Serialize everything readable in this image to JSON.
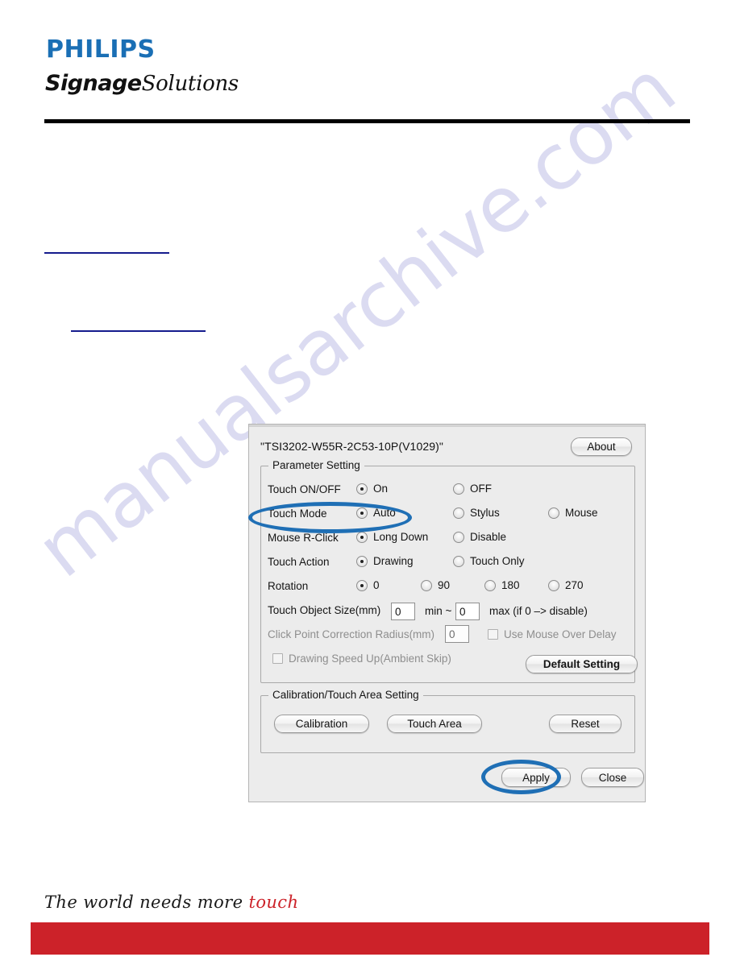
{
  "watermark": {
    "text": "manualsarchive.com"
  },
  "header": {
    "brand": "PHILIPS",
    "sub_bold": "Signage",
    "sub_light": "Solutions"
  },
  "dialog": {
    "device_id": "\"TSI3202-W55R-2C53-10P(V1029)\"",
    "about_label": "About",
    "parameter_group_label": "Parameter Setting",
    "rows": {
      "touch_onoff": {
        "label": "Touch ON/OFF",
        "options": [
          "On",
          "OFF"
        ],
        "selected": "On"
      },
      "touch_mode": {
        "label": "Touch Mode",
        "options": [
          "Auto",
          "Stylus",
          "Mouse"
        ],
        "selected": "Auto"
      },
      "mouse_rclick": {
        "label": "Mouse R-Click",
        "options": [
          "Long Down",
          "Disable"
        ],
        "selected": "Long Down"
      },
      "touch_action": {
        "label": "Touch Action",
        "options": [
          "Drawing",
          "Touch Only"
        ],
        "selected": "Drawing"
      },
      "rotation": {
        "label": "Rotation",
        "options": [
          "0",
          "90",
          "180",
          "270"
        ],
        "selected": "0"
      },
      "touch_object_size": {
        "label": "Touch Object Size(mm)",
        "min_value": "0",
        "mid_label": "min ~",
        "max_value": "0",
        "suffix": "max (if 0 –> disable)"
      },
      "click_point_correction": {
        "label": "Click Point Correction Radius(mm)",
        "value": "0",
        "disabled": true
      },
      "use_mouse_over_delay": {
        "label": "Use Mouse Over Delay",
        "checked": false,
        "disabled": true
      },
      "drawing_speed_up": {
        "label": "Drawing Speed Up(Ambient Skip)",
        "checked": false,
        "disabled": true
      }
    },
    "default_setting_label": "Default Setting",
    "calibration_group_label": "Calibration/Touch Area Setting",
    "calibration_label": "Calibration",
    "touch_area_label": "Touch Area",
    "reset_label": "Reset",
    "apply_label": "Apply",
    "close_label": "Close"
  },
  "footer": {
    "tagline_prefix": "The world needs more ",
    "tagline_accent": "touch"
  },
  "colors": {
    "brand_blue": "#1a6fb5",
    "annotation_blue": "#1f6fb5",
    "accent_red": "#cc2229",
    "link_blue": "#151b8d",
    "dialog_bg": "#ececec"
  }
}
